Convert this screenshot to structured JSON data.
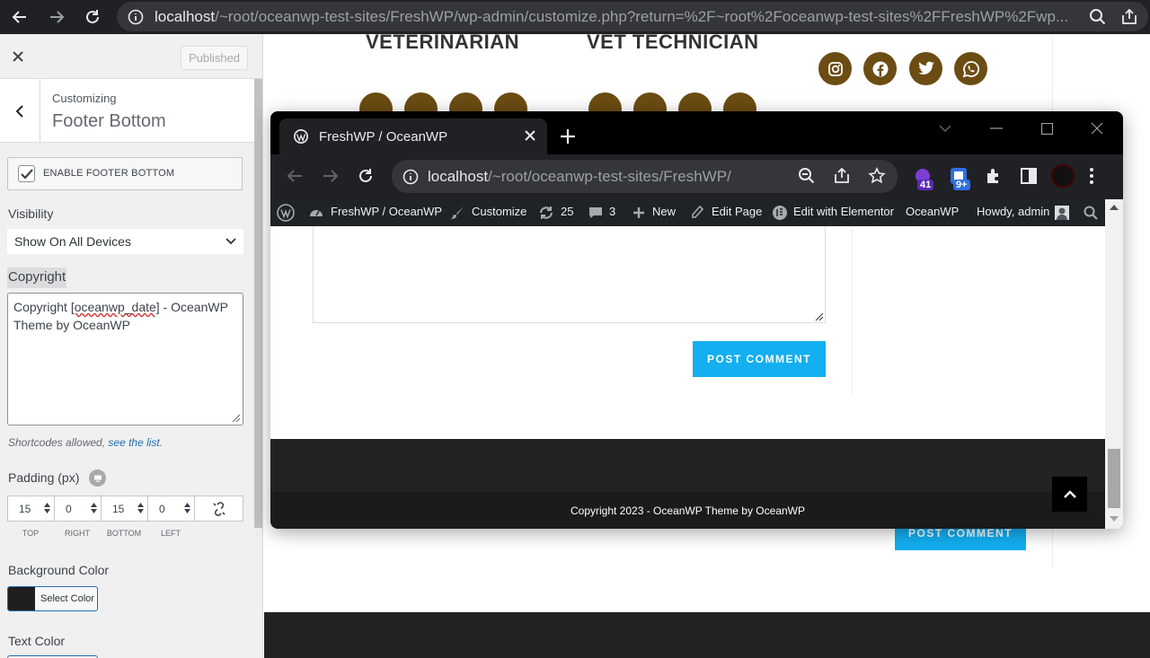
{
  "outer_browser": {
    "url_host": "localhost",
    "url_path": "/~root/oceanwp-test-sites/FreshWP/wp-admin/customize.php?return=%2F~root%2Foceanwp-test-sites%2FFreshWP%2Fwp..."
  },
  "customizer": {
    "published_label": "Published",
    "breadcrumb": "Customizing",
    "section_title": "Footer Bottom",
    "enable_label": "ENABLE FOOTER BOTTOM",
    "enable_checked": true,
    "visibility_label": "Visibility",
    "visibility_value": "Show On All Devices",
    "copyright_label": "Copyright",
    "copyright_text_pre": "Copyright ",
    "copyright_shortcode": "[oceanwp_date]",
    "copyright_text_post": " - OceanWP Theme by OceanWP",
    "hint_text": "Shortcodes allowed, ",
    "hint_link": "see the list",
    "hint_end": ".",
    "padding_label": "Padding (px)",
    "padding_values": [
      "15",
      "0",
      "15",
      "0"
    ],
    "padding_labels": [
      "TOP",
      "RIGHT",
      "BOTTOM",
      "LEFT"
    ],
    "bg_color_label": "Background Color",
    "select_color_label": "Select Color",
    "bg_color_value": "#1f1f1f",
    "text_color_label": "Text Color"
  },
  "preview_bg": {
    "label_left": "VETERINARIAN",
    "label_right": "VET TECHNICIAN",
    "post_comment": "POST COMMENT"
  },
  "popup_window": {
    "tab_title": "FreshWP / OceanWP",
    "url_host": "localhost",
    "url_path": "/~root/oceanwp-test-sites/FreshWP/",
    "ext_badge_1": "41",
    "ext_badge_2": "9+",
    "adminbar": {
      "site": "FreshWP / OceanWP",
      "customize": "Customize",
      "updates": "25",
      "comments": "3",
      "new": "New",
      "edit_page": "Edit Page",
      "elementor": "Edit with Elementor",
      "oceanwp": "OceanWP",
      "howdy": "Howdy, admin"
    },
    "post_comment": "POST COMMENT",
    "footer_copyright": "Copyright 2023 - OceanWP Theme by OceanWP"
  },
  "colors": {
    "accent": "#13aff0",
    "social_bg": "#6b4c13",
    "link": "#2271b1"
  }
}
